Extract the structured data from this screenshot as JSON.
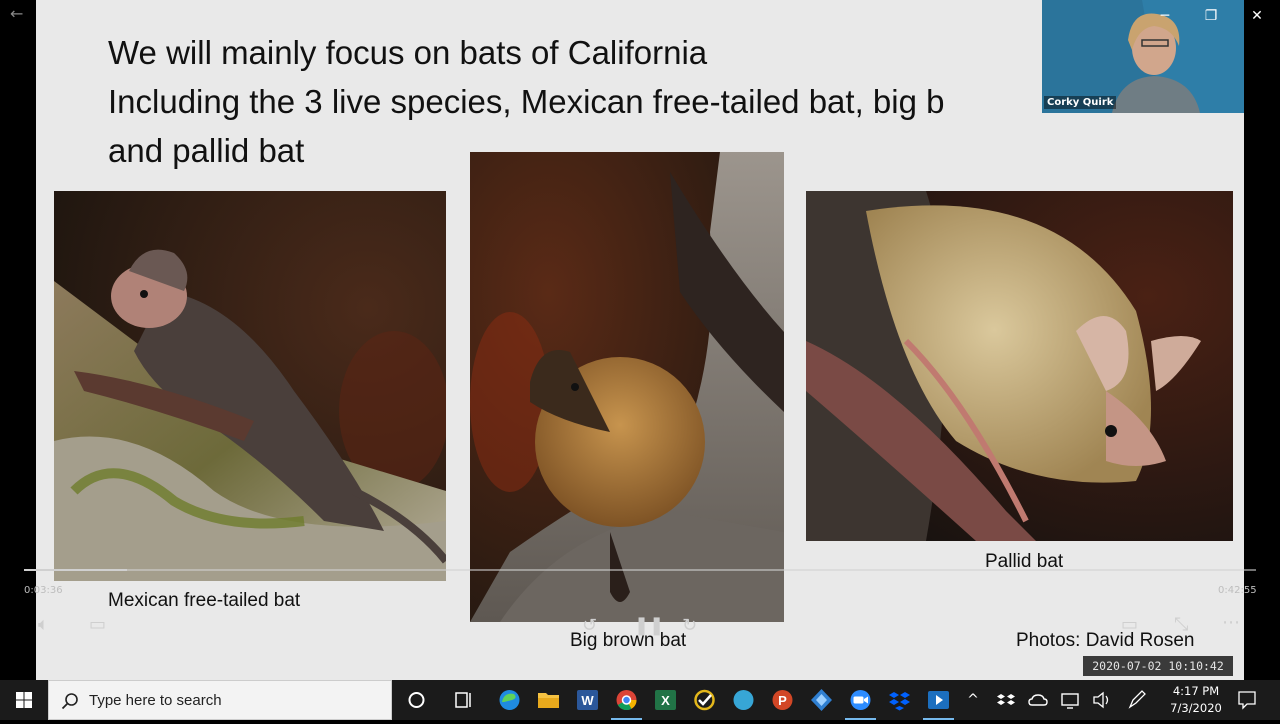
{
  "slide": {
    "title_lines": [
      "We will mainly focus on bats of California",
      "Including the 3 live species, Mexican free-tailed bat, big b",
      "and pallid bat"
    ],
    "captions": {
      "mexican": "Mexican free-tailed bat",
      "big_brown": "Big brown bat",
      "pallid": "Pallid bat",
      "credit": "Photos: David Rosen"
    }
  },
  "player": {
    "elapsed": "0:03:36",
    "duration": "0:42:55",
    "progress_fraction": 0.084,
    "timestamp": "2020-07-02  10:10:42"
  },
  "participant": {
    "name": "Corky Quirk"
  },
  "taskbar": {
    "search_placeholder": "Type here to search",
    "clock_time": "4:17 PM",
    "clock_date": "7/3/2020"
  },
  "colors": {
    "taskbar_bg": "#1b1b1b",
    "slide_bg": "#e9e9e9",
    "active_indicator": "#76b9ed"
  }
}
